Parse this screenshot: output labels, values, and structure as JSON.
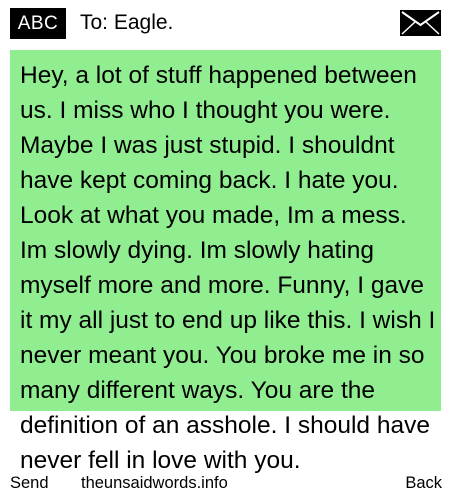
{
  "header": {
    "input_mode": "ABC",
    "recipient": "To: Eagle.",
    "send_icon": "envelope-icon"
  },
  "message": {
    "body": "Hey, a lot of stuff happened between us. I miss who I thought you were. Maybe I was just stupid. I shouldnt have kept coming back. I hate you. Look at what you made, Im a mess. Im slowly dying. Im slowly hating myself more and more. Funny, I gave it my all just to end up like this. I wish I never meant you. You broke me in so many different ways. You are the definition of an asshole. I should have never fell in love with you."
  },
  "softkeys": {
    "left": "Send",
    "center": "theunsaidwords.info",
    "right": "Back"
  },
  "colors": {
    "message_background": "#90ee90",
    "badge_background": "#000000",
    "badge_text": "#ffffff"
  }
}
